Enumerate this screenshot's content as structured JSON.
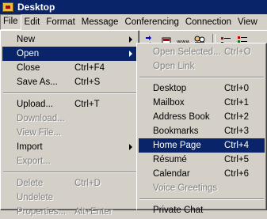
{
  "window": {
    "title": "Desktop",
    "icon": "desktop-app-icon"
  },
  "menubar": [
    {
      "label": "File",
      "active": true
    },
    {
      "label": "Edit"
    },
    {
      "label": "Format"
    },
    {
      "label": "Message"
    },
    {
      "label": "Conferencing"
    },
    {
      "label": "Connection"
    },
    {
      "label": "View"
    }
  ],
  "file_menu": {
    "new": {
      "label": "New",
      "submenu": true
    },
    "open": {
      "label": "Open",
      "submenu": true,
      "highlighted": true
    },
    "close": {
      "label": "Close",
      "shortcut": "Ctrl+F4"
    },
    "save_as": {
      "label": "Save As...",
      "shortcut": "Ctrl+S"
    },
    "upload": {
      "label": "Upload...",
      "shortcut": "Ctrl+T"
    },
    "download": {
      "label": "Download...",
      "disabled": true
    },
    "view_file": {
      "label": "View File...",
      "disabled": true
    },
    "import": {
      "label": "Import",
      "submenu": true
    },
    "export": {
      "label": "Export...",
      "disabled": true
    },
    "delete": {
      "label": "Delete",
      "shortcut": "Ctrl+D",
      "disabled": true
    },
    "undelete": {
      "label": "Undelete",
      "disabled": true
    },
    "properties": {
      "label": "Properties...",
      "shortcut": "Alt+Enter",
      "disabled": true
    }
  },
  "open_submenu": {
    "open_selected": {
      "label": "Open Selected...",
      "shortcut": "Ctrl+O",
      "disabled": true
    },
    "open_link": {
      "label": "Open Link",
      "disabled": true
    },
    "desktop": {
      "label": "Desktop",
      "shortcut": "Ctrl+0"
    },
    "mailbox": {
      "label": "Mailbox",
      "shortcut": "Ctrl+1"
    },
    "address_book": {
      "label": "Address Book",
      "shortcut": "Ctrl+2"
    },
    "bookmarks": {
      "label": "Bookmarks",
      "shortcut": "Ctrl+3"
    },
    "home_page": {
      "label": "Home Page",
      "shortcut": "Ctrl+4",
      "highlighted": true
    },
    "resume": {
      "label": "Résumé",
      "shortcut": "Ctrl+5"
    },
    "calendar": {
      "label": "Calendar",
      "shortcut": "Ctrl+6"
    },
    "voice_greetings": {
      "label": "Voice Greetings",
      "disabled": true
    },
    "private_chat": {
      "label": "Private Chat"
    }
  },
  "toolbar_icons": [
    "inbox-arrows-icon",
    "mailbox-icon",
    "www-icon",
    "people-search-icon",
    "list-view-icon",
    "details-view-icon"
  ],
  "colors": {
    "highlight": "#0a246a",
    "face": "#d4d0c8",
    "disabled": "#808080"
  }
}
